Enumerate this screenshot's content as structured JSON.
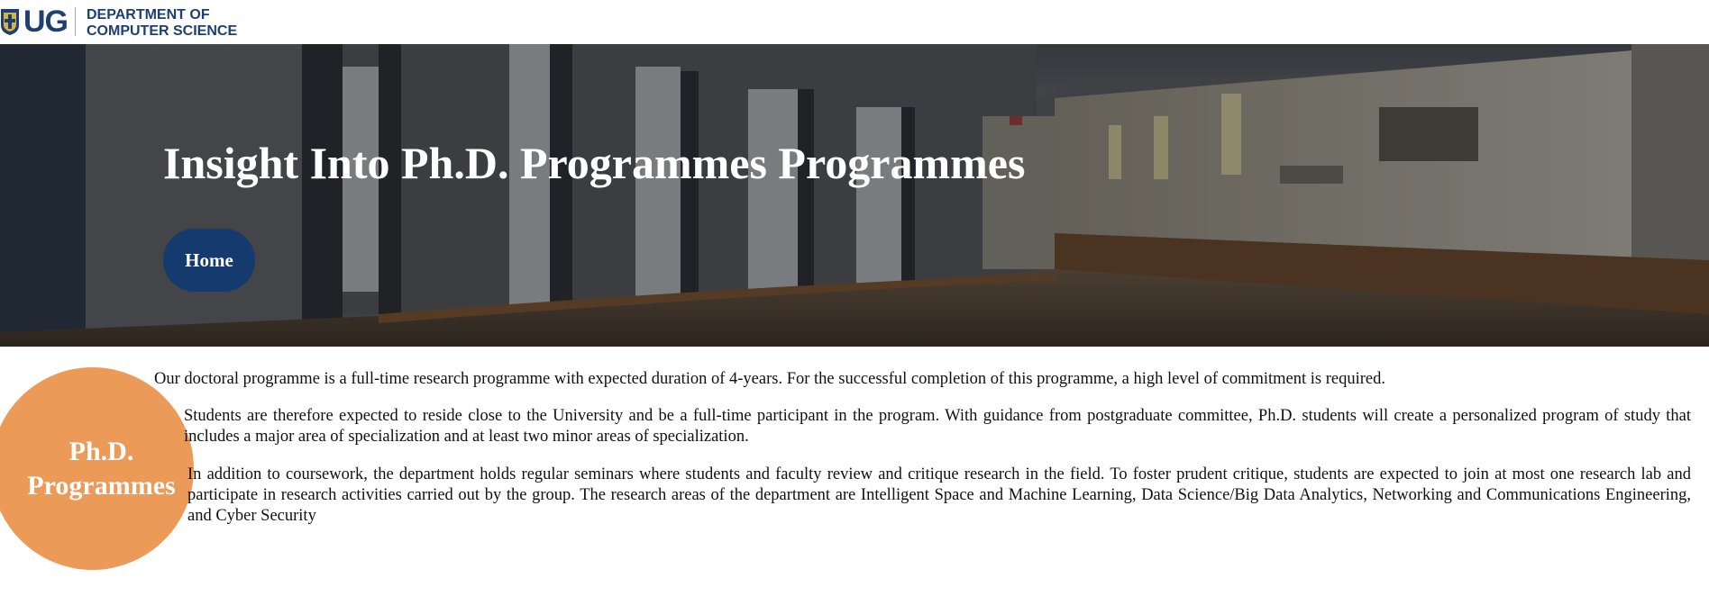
{
  "header": {
    "logo_mark": "UG",
    "logo_icon": "university-crest-icon",
    "department_line1": "DEPARTMENT OF",
    "department_line2": "COMPUTER SCIENCE"
  },
  "hero": {
    "title": "Insight Into Ph.D. Programmes Programmes",
    "home_button": "Home"
  },
  "badge": {
    "line1": "Ph.D.",
    "line2": "Programmes"
  },
  "content": {
    "paragraphs": [
      "Our doctoral programme is a full-time research programme with expected duration of 4-years. For the successful completion of this programme, a high level of commitment is required.",
      "Students are therefore expected to reside close to the University and be a full-time participant in the program. With guidance from postgraduate committee, Ph.D. students will create a personalized program of study that includes a major area of specialization and at least two minor areas of specialization.",
      "In addition to coursework, the department holds regular seminars where students and faculty review and critique research in the field. To foster prudent critique, students are expected to join at most one research lab and participate in research activities carried out by the group. The research areas of the department are Intelligent Space and Machine Learning, Data Science/Big Data Analytics, Networking and Communications Engineering, and Cyber Security"
    ]
  },
  "colors": {
    "brand_blue": "#1d3f73",
    "button_blue": "#143a6e",
    "badge_orange": "#eb9a58"
  }
}
